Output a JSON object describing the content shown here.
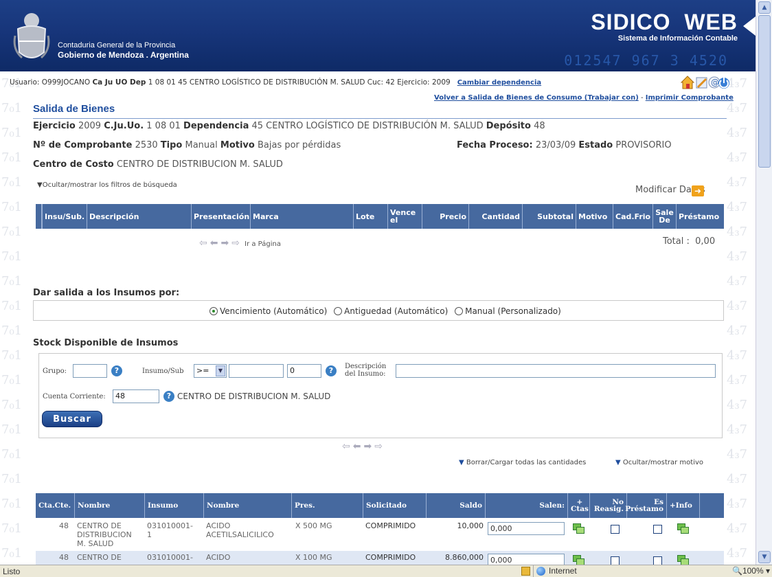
{
  "header": {
    "org_line1": "Contaduria General de la Provincia",
    "org_line2": "Gobierno de Mendoza . Argentina",
    "brand": "SIDICO  WEB",
    "brand_sub": "Sistema de Información Contable",
    "digits": "012547 967 3 4520 "
  },
  "userbar": {
    "usuario_label": "Usuario:",
    "usuario": "O999JOCANO",
    "cajuuo_label": "Ca Ju UO Dep",
    "cajuuo": "1 08 01 45",
    "dependencia": "CENTRO LOGÍSTICO DE DISTRIBUCIÓN M. SALUD",
    "cuc_label": "Cuc:",
    "cuc": "42",
    "ejercicio_label": "Ejercicio:",
    "ejercicio": "2009",
    "cambiar": "Cambiar dependencia"
  },
  "links": {
    "volver": "Volver a Salida de Bienes de Consumo (Trabajar con)",
    "sep": "-",
    "imprimir": "Imprimir Comprobante"
  },
  "page_title": "Salida de Bienes",
  "info": {
    "ejercicio_label": "Ejercicio",
    "ejercicio": "2009",
    "cjuuo_label": "C.Ju.Uo.",
    "cjuuo": "1 08 01",
    "dependencia_label": "Dependencia",
    "dependencia": "45 CENTRO LOGÍSTICO DE DISTRIBUCIÓN M. SALUD",
    "deposito_label": "Depósito",
    "deposito": "48",
    "comprobante_label": "Nº de Comprobante",
    "comprobante": "2530",
    "tipo_label": "Tipo",
    "tipo": "Manual",
    "motivo_label": "Motivo",
    "motivo": "Bajas por pérdidas",
    "fecha_label": "Fecha Proceso:",
    "fecha": "23/03/09",
    "estado_label": "Estado",
    "estado": "PROVISORIO",
    "costo_label": "Centro de Costo",
    "costo": "CENTRO DE DISTRIBUCION M. SALUD"
  },
  "filtros_toggle": "Ocultar/mostrar los filtros de búsqueda",
  "modificar": "Modificar Datos",
  "grid1": {
    "headers": [
      "Insu/Sub.",
      "Descripción",
      "Presentación",
      "Marca",
      "Lote",
      "Vence el",
      "Precio",
      "Cantidad",
      "Subtotal",
      "Motivo",
      "Cad.Frio",
      "Sale De",
      "Préstamo"
    ],
    "pager_label": "Ir a Página",
    "total_label": "Total :",
    "total": "0,00"
  },
  "salida": {
    "title": "Dar salida a los Insumos por:",
    "options": [
      "Vencimiento (Automático)",
      "Antiguedad (Automático)",
      "Manual (Personalizado)"
    ],
    "selected": 0
  },
  "stock": {
    "title": "Stock Disponible de Insumos",
    "grupo_label": "Grupo:",
    "insumo_label": "Insumo/Sub",
    "operator": ">=",
    "insumo_sub": "0",
    "descripcion_label": "Descripción del Insumo:",
    "cuenta_label": "Cuenta Corriente:",
    "cuenta": "48",
    "cuenta_nombre": "CENTRO DE DISTRIBUCION M. SALUD",
    "buscar": "Buscar",
    "borrar": "Borrar/Cargar todas las cantidades",
    "ocultar_motivo": "Ocultar/mostrar motivo"
  },
  "grid2": {
    "headers": [
      "Cta.Cte.",
      "Nombre",
      "Insumo",
      "Nombre",
      "Pres.",
      "Solicitado",
      "Saldo",
      "Salen:",
      "+ Ctas",
      "No Reasig.",
      "Es Préstamo",
      "+Info"
    ],
    "rows": [
      {
        "ctacte": "48",
        "nombre": "CENTRO DE DISTRIBUCION M. SALUD",
        "insumo": "031010001-1",
        "insumo_nombre": "ACIDO ACETILSALICILICO",
        "pres": "X 500 MG",
        "solicitado": "COMPRIMIDO",
        "saldo": "10,000",
        "salen": "0,000"
      },
      {
        "ctacte": "48",
        "nombre": "CENTRO DE",
        "insumo": "031010001-",
        "insumo_nombre": "ACIDO",
        "pres": "X 100 MG",
        "solicitado": "COMPRIMIDO",
        "saldo": "8.860,000",
        "salen": "0,000"
      }
    ]
  },
  "status": {
    "left": "Listo",
    "zone": "Internet",
    "zoom": "100%"
  }
}
